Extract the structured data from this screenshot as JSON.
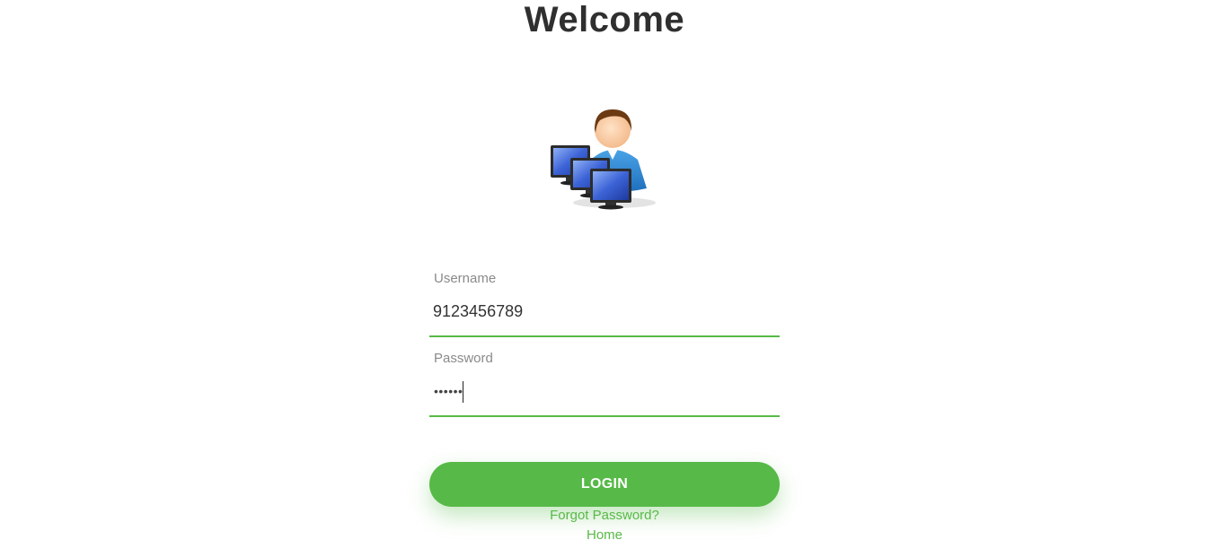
{
  "header": {
    "title": "Welcome"
  },
  "avatar": {
    "icon": "user-with-computers-icon"
  },
  "form": {
    "username": {
      "label": "Username",
      "value": "9123456789"
    },
    "password": {
      "label": "Password",
      "masked_value": "••••••"
    },
    "login_label": "LOGIN"
  },
  "links": {
    "forgot_password": "Forgot Password?",
    "home": "Home"
  },
  "colors": {
    "accent": "#57b947",
    "title": "#2f2f2f",
    "label": "#8a8a8a"
  }
}
